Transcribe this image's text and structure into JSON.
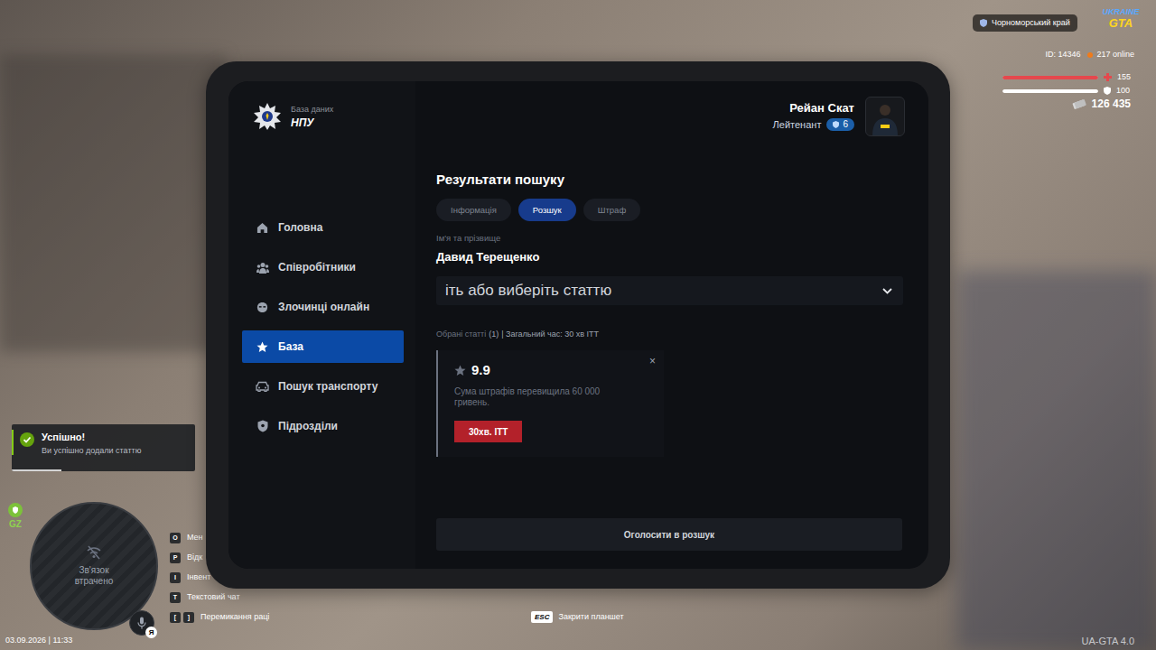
{
  "hud": {
    "region": "Чорноморський край",
    "logo": {
      "top": "UKRAINE",
      "bottom": "GTA"
    },
    "id": "ID: 14346",
    "online": "217 online",
    "health": {
      "value": "155",
      "level": 1
    },
    "armor": {
      "value": "100",
      "level": 1
    },
    "money": "126 435"
  },
  "tablet": {
    "brand": {
      "subtitle": "База даних",
      "title": "НПУ"
    },
    "user": {
      "name": "Рейан Скат",
      "rank": "Лейтенант",
      "level": "6"
    },
    "sidebar": [
      {
        "label": "Головна",
        "selected": false
      },
      {
        "label": "Співробітники",
        "selected": false
      },
      {
        "label": "Злочинці онлайн",
        "selected": false
      },
      {
        "label": "База",
        "selected": true
      },
      {
        "label": "Пошук транспорту",
        "selected": false
      },
      {
        "label": "Підрозділи",
        "selected": false
      }
    ],
    "title": "Результати пошуку",
    "tabs": [
      {
        "label": "Інформація",
        "selected": false
      },
      {
        "label": "Розшук",
        "selected": true
      },
      {
        "label": "Штраф",
        "selected": false
      }
    ],
    "name_label": "Ім'я та прізвище",
    "name": "Давид Терещенко",
    "article_search": {
      "value": "іть або виберіть статтю"
    },
    "summary": {
      "label": "Обрані статті",
      "count": "(1)",
      "total": "| Загальний час: 30 хв ІТТ"
    },
    "articles": [
      {
        "code": "9.9",
        "description": "Сума штрафів перевищила 60 000 гривень.",
        "penalty": "30хв. ІТТ",
        "remove": "×"
      }
    ],
    "submit": "Оголосити в розшук"
  },
  "notification": {
    "title": "Успішно!",
    "message": "Ви успішно додали статтю",
    "level": 0.27
  },
  "zone": "GZ",
  "minimap": {
    "status": "Зв'язок втрачено"
  },
  "keybinds": [
    {
      "keys": [
        "O"
      ],
      "label": "Мен"
    },
    {
      "keys": [
        "P"
      ],
      "label": "Відк"
    },
    {
      "keys": [
        "I"
      ],
      "label": "Інвент"
    },
    {
      "keys": [
        "T"
      ],
      "label": "Текстовий чат"
    },
    {
      "keys": [
        "[",
        "]"
      ],
      "label": "Перемикання раці"
    }
  ],
  "voice": {
    "key": "Я"
  },
  "datetime": "03.09.2026 | 11:33",
  "hint": {
    "key": "ESC",
    "label": "Закрити планшет"
  },
  "version": "UA-GTA 4.0"
}
